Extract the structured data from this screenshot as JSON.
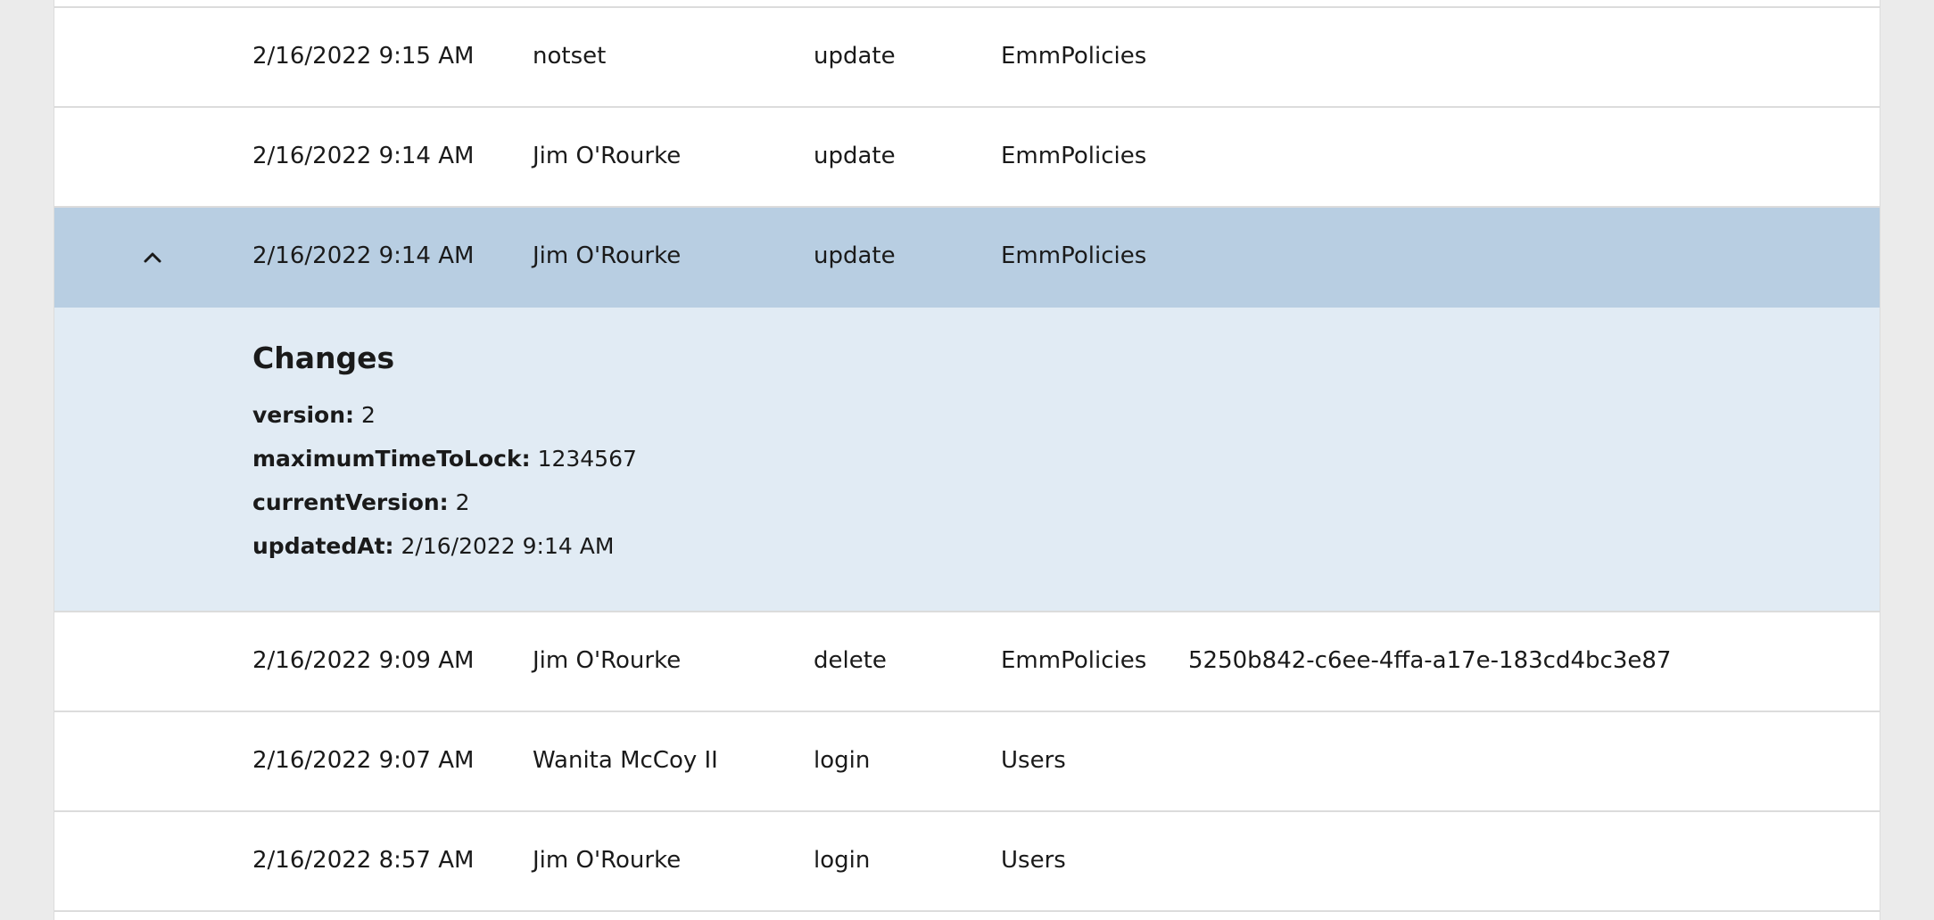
{
  "rows_before": [
    {
      "date": "2/16/2022 9:15 AM",
      "user": "notset",
      "action": "update",
      "type": "EmmPolicies",
      "id": ""
    },
    {
      "date": "2/16/2022 9:14 AM",
      "user": "Jim O'Rourke",
      "action": "update",
      "type": "EmmPolicies",
      "id": ""
    }
  ],
  "selected_row": {
    "date": "2/16/2022 9:14 AM",
    "user": "Jim O'Rourke",
    "action": "update",
    "type": "EmmPolicies",
    "toggle_icon": "chevron-up-icon"
  },
  "details": {
    "title": "Changes",
    "changes": [
      {
        "key": "version:",
        "value": "2"
      },
      {
        "key": "maximumTimeToLock:",
        "value": "1234567"
      },
      {
        "key": "currentVersion:",
        "value": "2"
      },
      {
        "key": "updatedAt:",
        "value": "2/16/2022 9:14 AM"
      }
    ]
  },
  "rows_after": [
    {
      "date": "2/16/2022 9:09 AM",
      "user": "Jim O'Rourke",
      "action": "delete",
      "type": "EmmPolicies",
      "id": "5250b842-c6ee-4ffa-a17e-183cd4bc3e87"
    },
    {
      "date": "2/16/2022 9:07 AM",
      "user": "Wanita McCoy II",
      "action": "login",
      "type": "Users",
      "id": ""
    },
    {
      "date": "2/16/2022 8:57 AM",
      "user": "Jim O'Rourke",
      "action": "login",
      "type": "Users",
      "id": ""
    }
  ],
  "colors": {
    "selected_row": "#b8cee2",
    "details_background": "#e1ebf4",
    "page_background": "#ebebeb"
  }
}
